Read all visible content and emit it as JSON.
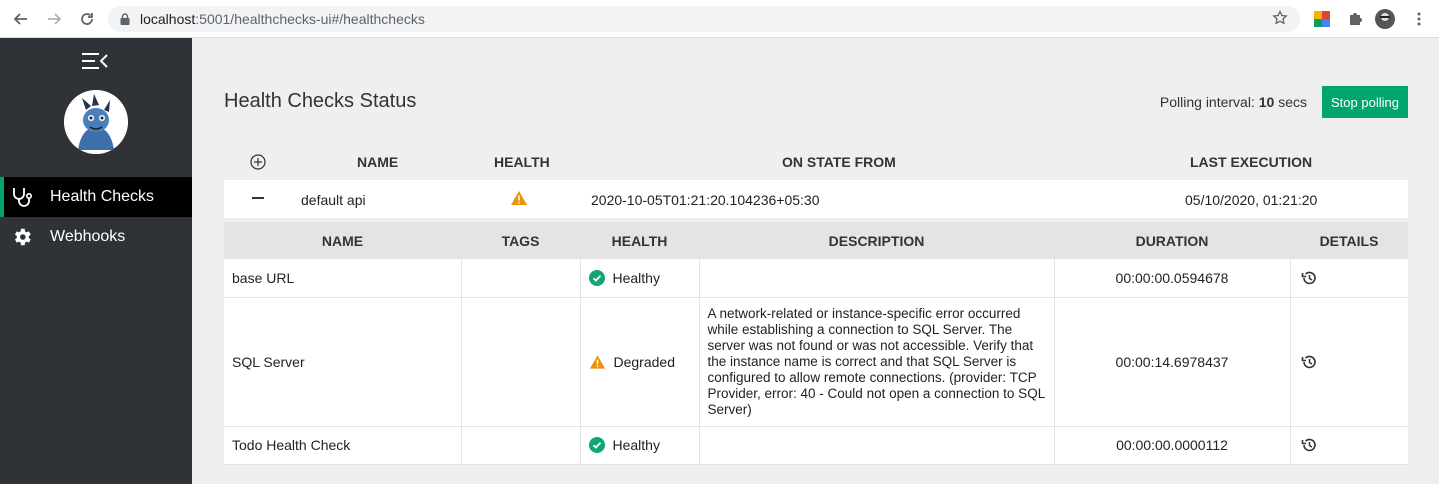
{
  "browser": {
    "url_host": "localhost",
    "url_path": ":5001/healthchecks-ui#/healthchecks"
  },
  "sidebar": {
    "items": [
      {
        "label": "Health Checks",
        "icon": "stethoscope-icon",
        "active": true
      },
      {
        "label": "Webhooks",
        "icon": "gear-icon",
        "active": false
      }
    ]
  },
  "header": {
    "title": "Health Checks Status",
    "polling_prefix": "Polling interval: ",
    "polling_value": "10",
    "polling_suffix": " secs",
    "stop_label": "Stop polling"
  },
  "outer_table": {
    "columns": [
      "NAME",
      "HEALTH",
      "ON STATE FROM",
      "LAST EXECUTION"
    ],
    "row": {
      "name": "default api",
      "health": "warning",
      "on_state_from": "2020-10-05T01:21:20.104236+05:30",
      "last_execution": "05/10/2020, 01:21:20"
    }
  },
  "inner_table": {
    "columns": [
      "NAME",
      "TAGS",
      "HEALTH",
      "DESCRIPTION",
      "DURATION",
      "DETAILS"
    ],
    "rows": [
      {
        "name": "base URL",
        "tags": "",
        "health": "Healthy",
        "description": "",
        "duration": "00:00:00.0594678"
      },
      {
        "name": "SQL Server",
        "tags": "",
        "health": "Degraded",
        "description": "A network-related or instance-specific error occurred while establishing a connection to SQL Server. The server was not found or was not accessible. Verify that the instance name is correct and that SQL Server is configured to allow remote connections. (provider: TCP Provider, error: 40 - Could not open a connection to SQL Server)",
        "duration": "00:00:14.6978437"
      },
      {
        "name": "Todo Health Check",
        "tags": "",
        "health": "Healthy",
        "description": "",
        "duration": "00:00:00.0000112"
      }
    ]
  },
  "colors": {
    "accent": "#00a66e",
    "healthy": "#12a577",
    "degraded": "#f0910a",
    "sidebar_bg": "#2f3236"
  }
}
